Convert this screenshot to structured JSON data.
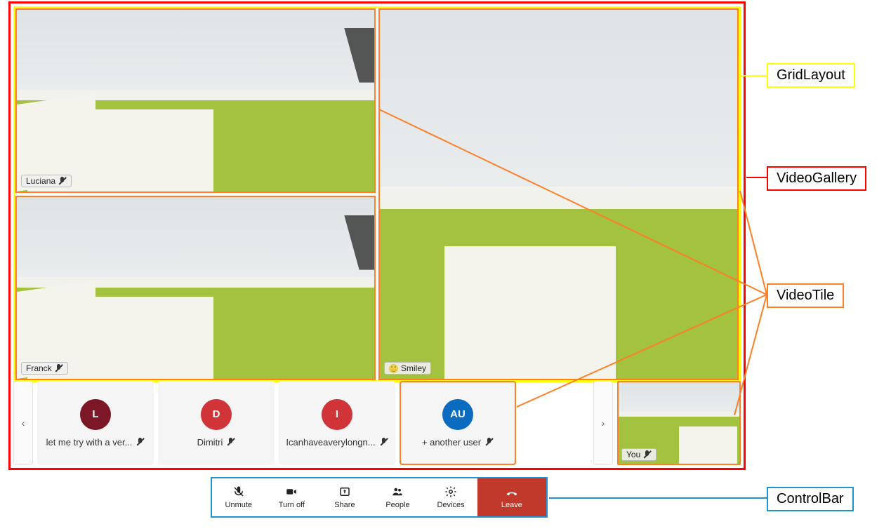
{
  "grid": {
    "tiles": [
      {
        "name": "Luciana",
        "muted": true
      },
      {
        "name": "Franck",
        "muted": true
      },
      {
        "name": "Smiley",
        "muted": false,
        "smiley": true
      }
    ]
  },
  "overflow": {
    "prev_label": "‹",
    "next_label": "›",
    "tiles": [
      {
        "initials": "L",
        "color": "#7b1726",
        "name": "let me try with a ver...",
        "muted": true
      },
      {
        "initials": "D",
        "color": "#d13438",
        "name": "Dimitri",
        "muted": true
      },
      {
        "initials": "I",
        "color": "#d13438",
        "name": "Icanhaveaverylongn...",
        "muted": true
      },
      {
        "initials": "AU",
        "color": "#0b6cbf",
        "name": "+ another user",
        "muted": true,
        "highlighted": true
      }
    ]
  },
  "self": {
    "name": "You",
    "muted": true
  },
  "controlbar": {
    "unmute": "Unmute",
    "turnoff": "Turn off",
    "share": "Share",
    "people": "People",
    "devices": "Devices",
    "leave": "Leave"
  },
  "annotations": {
    "gridlayout": "GridLayout",
    "videogallery": "VideoGallery",
    "videotile": "VideoTile",
    "controlbar": "ControlBar"
  }
}
